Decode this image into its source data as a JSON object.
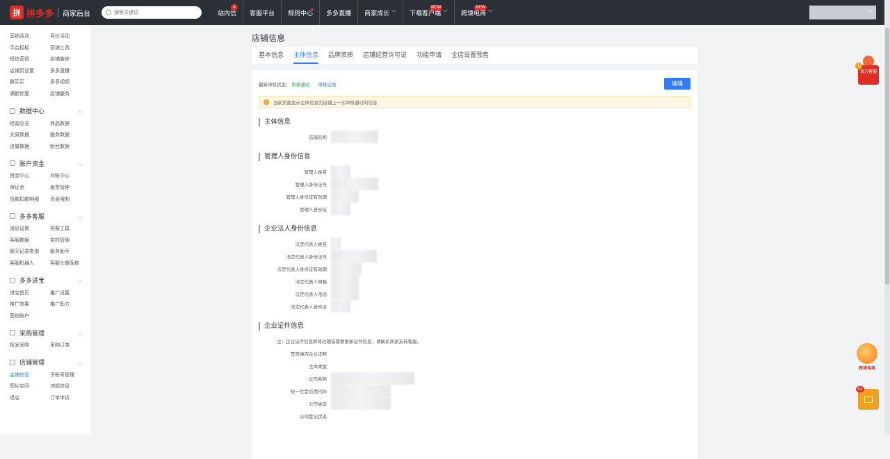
{
  "header": {
    "logo_mark": "拼",
    "brand": "拼多多",
    "admin_label": "商家后台",
    "search_placeholder": "搜索关键词",
    "nav": [
      {
        "label": "站内信",
        "badge": "4"
      },
      {
        "label": "客服平台"
      },
      {
        "label": "规则中心"
      },
      {
        "label": "多多直播"
      },
      {
        "label": "商家成长"
      },
      {
        "label": "下载客户端",
        "badge": "NEW"
      },
      {
        "label": "跨境电商",
        "badge": "NEW"
      }
    ]
  },
  "sidebar": {
    "top_items": [
      "营销活动",
      "竞价活动",
      "平台招标",
      "营销工具",
      "短信营销",
      "店铺装修",
      "店铺页设置",
      "多多直播",
      "群买买",
      "多多视频",
      "满额优惠",
      "店铺服务"
    ],
    "groups": [
      {
        "title": "数据中心",
        "items": [
          "经营总览",
          "商品数据",
          "交易数据",
          "服务数据",
          "流量数据",
          "粉丝数据"
        ]
      },
      {
        "title": "账户资金",
        "items": [
          "资金中心",
          "对账中心",
          "保证金",
          "发票管理",
          "货款扣款明细",
          "资金限制"
        ]
      },
      {
        "title": "多多客服",
        "items": [
          "消息设置",
          "客服工具",
          "客服数据",
          "实时管理",
          "聊天记录查询",
          "服务助手",
          "客服机器人",
          "客服头像昵称"
        ]
      },
      {
        "title": "多多进宝",
        "items": [
          "进宝首页",
          "推广设置",
          "推广效果",
          "推广助力",
          "营销账户"
        ]
      },
      {
        "title": "采购管理",
        "items": [
          "批发采购",
          "采购订单"
        ]
      },
      {
        "title": "店铺管理",
        "items": [
          "店铺信息",
          "子账号管理",
          "图片空间",
          "违规信息",
          "退店",
          "订单申诉"
        ]
      }
    ]
  },
  "main": {
    "title": "店铺信息",
    "tabs": [
      "基本信息",
      "主体信息",
      "品牌资质",
      "店铺经营许可证",
      "功能申请",
      "全店设置预售"
    ],
    "active_tab": "主体信息",
    "status_label": "最新审核状态：",
    "status_value": "审核通过",
    "audit_link": "审核记录",
    "edit_button": "编辑",
    "notice": "当前页面显示主体信息为店铺上一次审核通过的信息",
    "sections": [
      {
        "title": "主体信息",
        "fields": [
          "店铺名称"
        ]
      },
      {
        "title": "管理人身份信息",
        "fields": [
          "管理人姓名",
          "管理人身份证号",
          "管理人身份证有效期",
          "管理人身份证"
        ]
      },
      {
        "title": "企业法人身份信息",
        "fields": [
          "法定代表人姓名",
          "法定代表人身份证号",
          "法定代表人身份证有效期",
          "法定代表人邮箱",
          "法定代表人电话",
          "法定代表人身份证"
        ]
      },
      {
        "title": "企业证件信息",
        "fields": [
          "注：企业证件信息即将过期或需要更新证件信息，请联系商家支持客服。",
          "是否境内企业证照",
          "主体类型",
          "公司名称",
          "统一社会信用代码",
          "公司类型",
          "公司登记状态"
        ]
      }
    ]
  },
  "floating": {
    "service_label": "官方客服",
    "service_badge": "1",
    "cross_label": "跨境电商",
    "msg_badge": "62"
  },
  "colors": {
    "brand": "#e02e24",
    "accent": "#2f7cf6",
    "success": "#12a75a",
    "topbar": "#2b2f36"
  }
}
